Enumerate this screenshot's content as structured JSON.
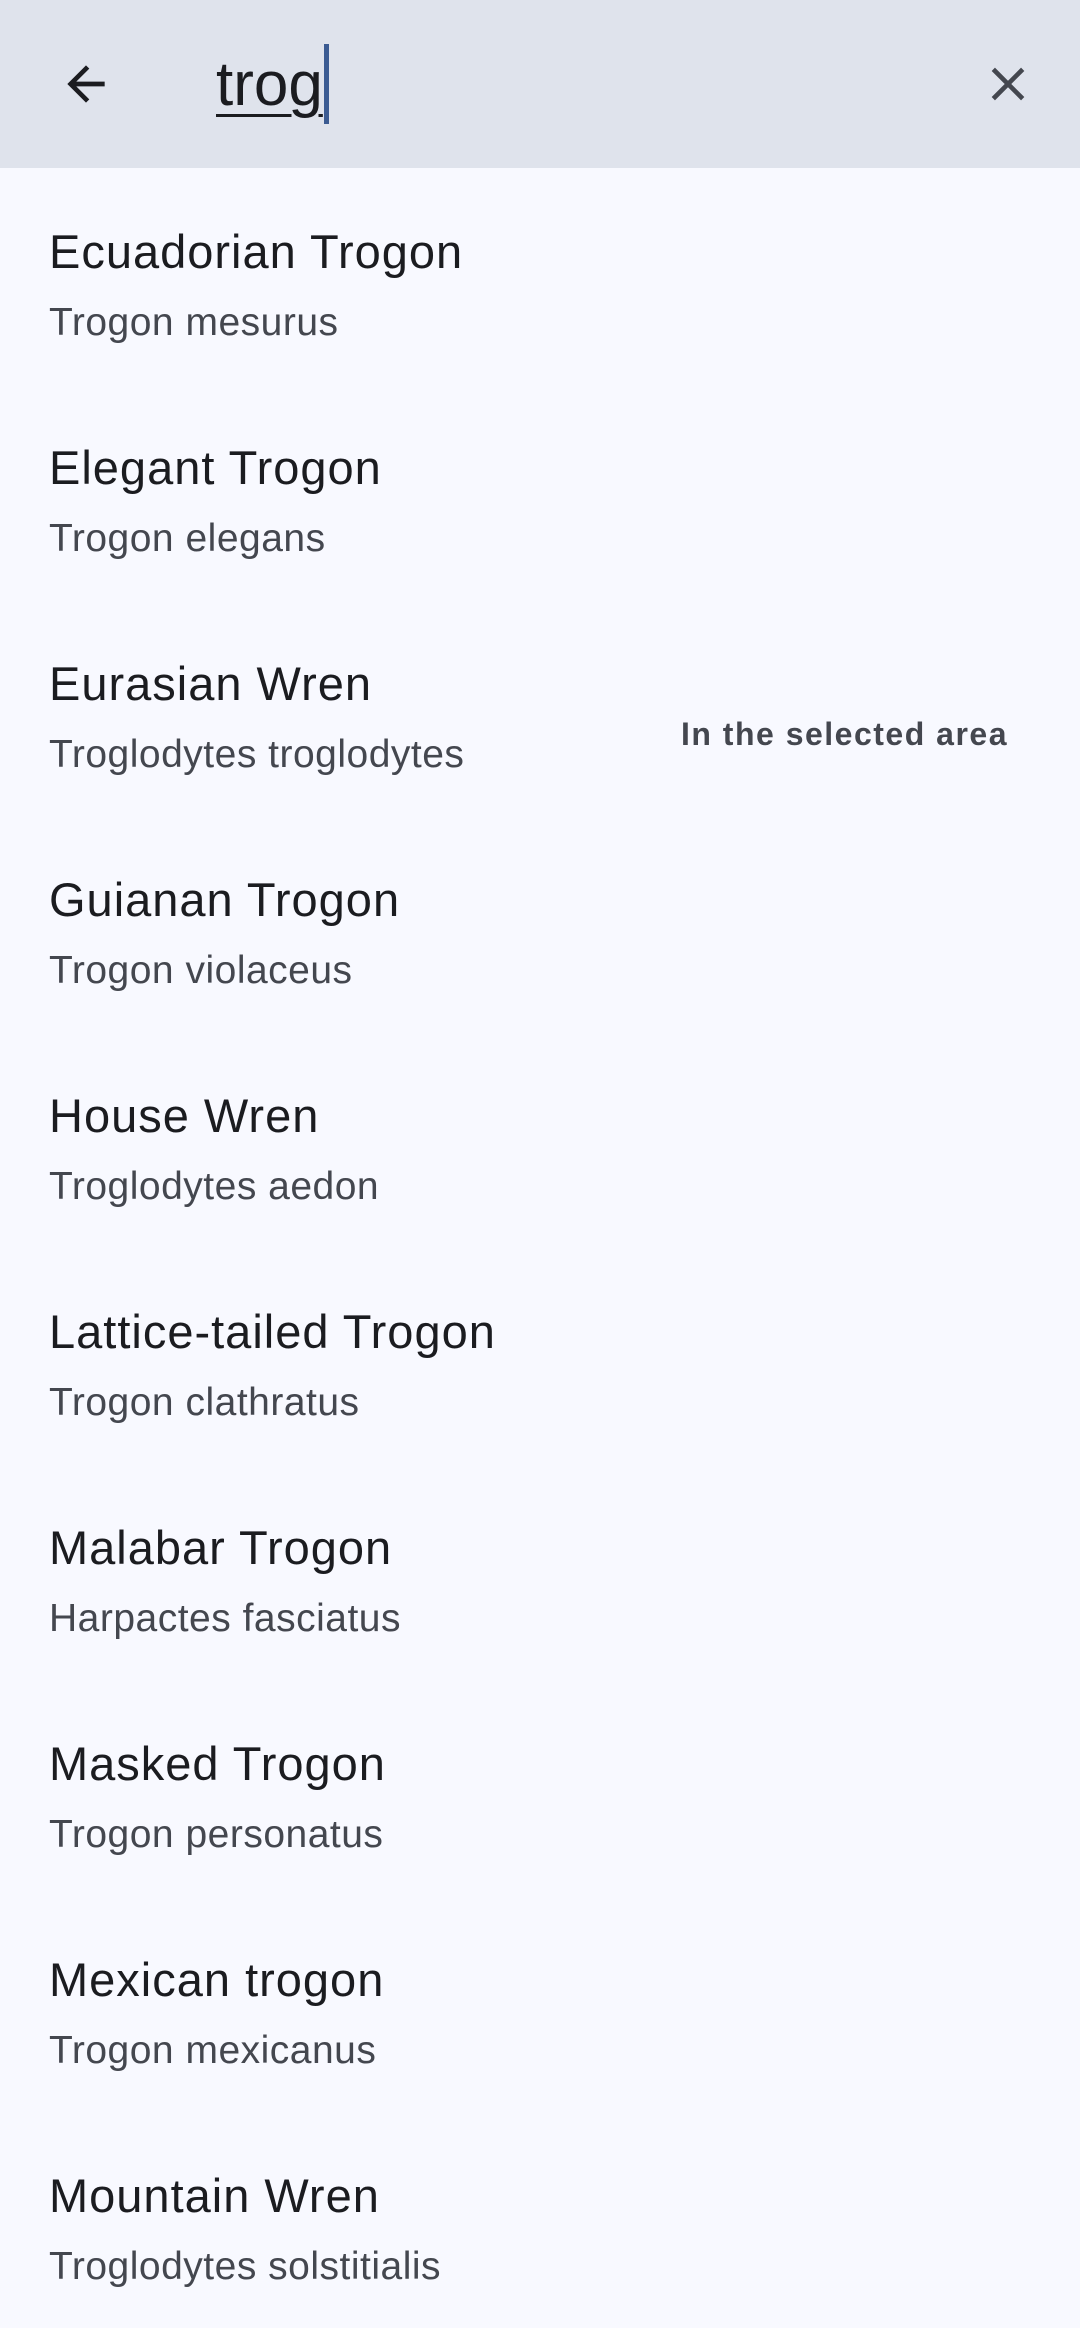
{
  "search": {
    "query": "trog",
    "back_icon": "arrow-back-icon",
    "clear_icon": "close-icon"
  },
  "colors": {
    "header_bg": "#dfe3ec",
    "page_bg": "#f8f9ff",
    "caret": "#3b5b92"
  },
  "results": [
    {
      "common": "Ecuadorian Trogon",
      "scientific": "Trogon mesurus",
      "badge": ""
    },
    {
      "common": "Elegant Trogon",
      "scientific": "Trogon elegans",
      "badge": ""
    },
    {
      "common": "Eurasian Wren",
      "scientific": "Troglodytes troglodytes",
      "badge": "In the selected area"
    },
    {
      "common": "Guianan Trogon",
      "scientific": "Trogon violaceus",
      "badge": ""
    },
    {
      "common": "House Wren",
      "scientific": "Troglodytes aedon",
      "badge": ""
    },
    {
      "common": "Lattice-tailed Trogon",
      "scientific": "Trogon clathratus",
      "badge": ""
    },
    {
      "common": "Malabar Trogon",
      "scientific": "Harpactes fasciatus",
      "badge": ""
    },
    {
      "common": "Masked Trogon",
      "scientific": "Trogon personatus",
      "badge": ""
    },
    {
      "common": "Mexican trogon",
      "scientific": "Trogon mexicanus",
      "badge": ""
    },
    {
      "common": "Mountain Wren",
      "scientific": "Troglodytes solstitialis",
      "badge": ""
    }
  ]
}
